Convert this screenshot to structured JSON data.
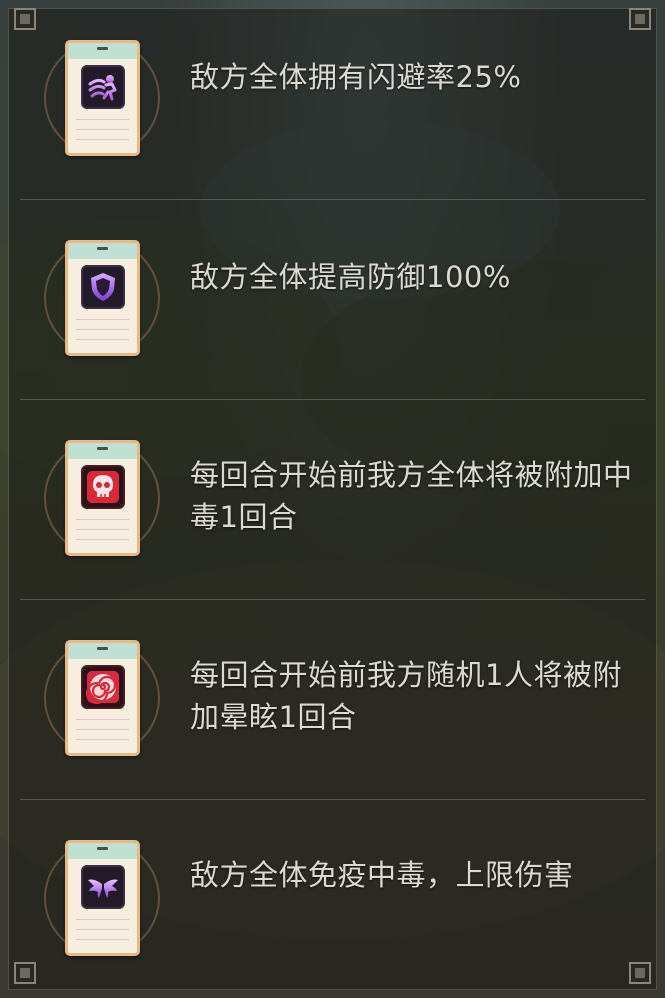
{
  "effects": [
    {
      "icon": "dodge-icon",
      "icon_color": "#b873e6",
      "text": "敌方全体拥有闪避率25%"
    },
    {
      "icon": "shield-icon",
      "icon_color": "#9a5fe0",
      "text": "敌方全体提高防御100%"
    },
    {
      "icon": "skull-icon",
      "icon_color": "#e03a4a",
      "text": "每回合开始前我方全体将被附加中毒1回合"
    },
    {
      "icon": "swirl-icon",
      "icon_color": "#e0344a",
      "text": "每回合开始前我方随机1人将被附加晕眩1回合"
    },
    {
      "icon": "wings-icon",
      "icon_color": "#a86ae8",
      "text": "敌方全体免疫中毒，上限伤害"
    }
  ]
}
